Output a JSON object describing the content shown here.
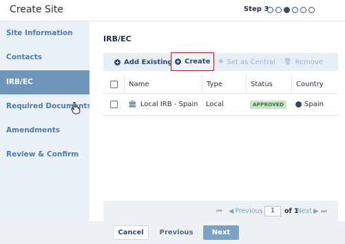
{
  "header": {
    "title": "Create Site",
    "step_label": "Step 3",
    "step_total": 6,
    "step_current": 3
  },
  "sidebar": {
    "items": [
      {
        "label": "Site Information",
        "active": false
      },
      {
        "label": "Contacts",
        "active": false
      },
      {
        "label": "IRB/EC",
        "active": true
      },
      {
        "label": "Required Documents",
        "active": false
      },
      {
        "label": "Amendments",
        "active": false
      },
      {
        "label": "Review & Confirm",
        "active": false
      }
    ]
  },
  "main": {
    "section_title": "IRB/EC",
    "toolbar": {
      "add_existing": "Add Existing",
      "create": "Create",
      "set_as_central": "Set as Central",
      "remove": "Remove"
    },
    "grid": {
      "columns": [
        "Name",
        "Type",
        "Status",
        "Country"
      ],
      "rows": [
        {
          "name": "Local IRB - Spain",
          "type": "Local",
          "status": "APPROVED",
          "country": "Spain"
        }
      ]
    },
    "pager": {
      "previous": "Previous",
      "page": "1",
      "of": "of 1",
      "next": "Next"
    }
  },
  "footer": {
    "cancel": "Cancel",
    "previous": "Previous",
    "next": "Next"
  },
  "colors": {
    "accent": "#4f7ba8",
    "active_nav": "#6f97bd",
    "selected_border": "#9b1c22",
    "approved_badge": "#c8e4c6"
  }
}
